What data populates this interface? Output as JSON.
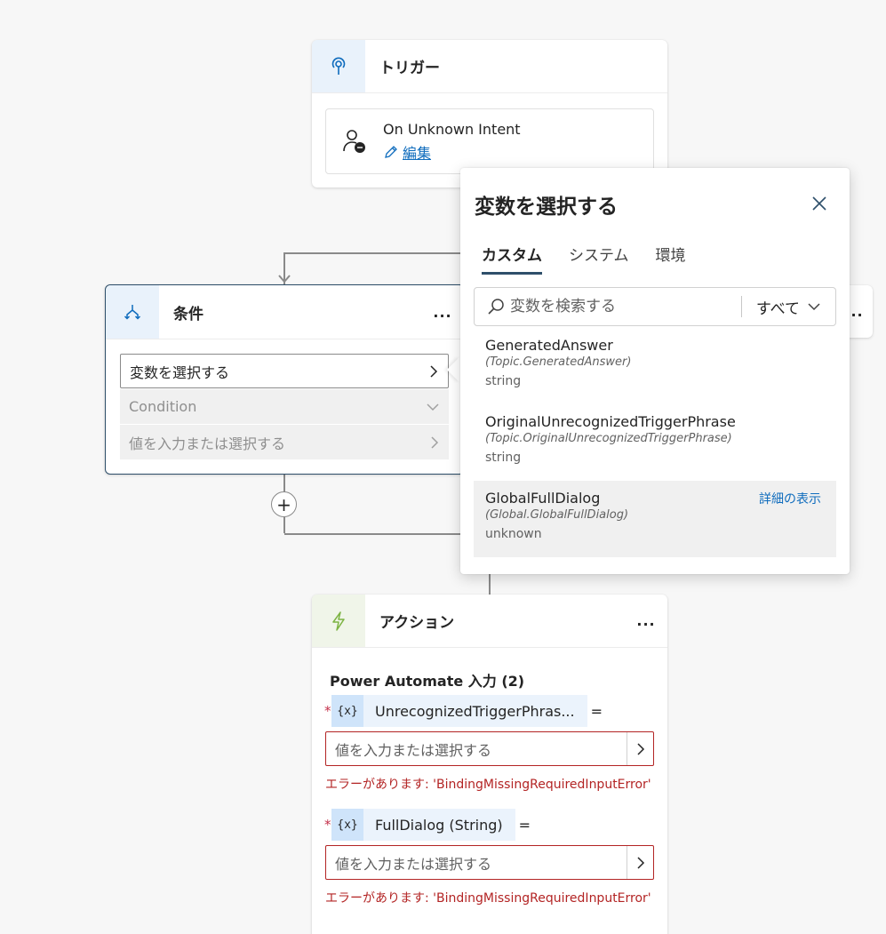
{
  "trigger": {
    "title": "トリガー",
    "event_name": "On Unknown Intent",
    "edit_label": "編集"
  },
  "condition": {
    "title": "条件",
    "more_label": "...",
    "variable_placeholder": "変数を選択する",
    "operator_placeholder": "Condition",
    "value_placeholder": "値を入力または選択する"
  },
  "add_node_label": "+",
  "right_card": {
    "more_label": "..."
  },
  "action": {
    "title": "アクション",
    "more_label": "...",
    "section_title": "Power Automate 入力 (2)",
    "required_mark": "*",
    "equals": "=",
    "var_icon": "{x}",
    "params": [
      {
        "name": "UnrecognizedTriggerPhras...",
        "value_placeholder": "値を入力または選択する",
        "error": "エラーがあります: 'BindingMissingRequiredInputError'"
      },
      {
        "name": "FullDialog (String)",
        "value_placeholder": "値を入力または選択する",
        "error": "エラーがあります: 'BindingMissingRequiredInputError'"
      }
    ]
  },
  "popover": {
    "title": "変数を選択する",
    "tabs": [
      "カスタム",
      "システム",
      "環境"
    ],
    "active_tab": 0,
    "search_placeholder": "変数を検索する",
    "filter_label": "すべて",
    "variables": [
      {
        "name": "GeneratedAnswer",
        "path": "(Topic.GeneratedAnswer)",
        "type": "string"
      },
      {
        "name": "OriginalUnrecognizedTriggerPhrase",
        "path": "(Topic.OriginalUnrecognizedTriggerPhrase)",
        "type": "string"
      },
      {
        "name": "GlobalFullDialog",
        "path": "(Global.GlobalFullDialog)",
        "type": "unknown",
        "details_label": "詳細の表示"
      }
    ]
  },
  "colors": {
    "accent": "#0f6cbd",
    "error": "#b32424",
    "selected_border": "#2e4f6a",
    "action_icon": "#7cb342"
  },
  "icons": {
    "trigger": "trigger-pin-icon",
    "condition": "branch-icon",
    "action": "lightning-icon",
    "close": "close-icon",
    "search": "search-icon"
  }
}
